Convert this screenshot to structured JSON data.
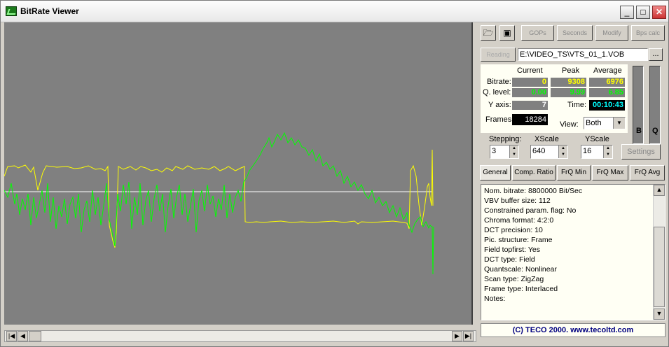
{
  "window": {
    "title": "BitRate Viewer"
  },
  "toolbar": {
    "open_icon": "folder-open-icon",
    "save_icon": "floppy-save-icon",
    "gops": "GOPs",
    "seconds": "Seconds",
    "modify": "Modify",
    "bps_calc": "Bps calc"
  },
  "file": {
    "reading_label": "Reading",
    "path": "E:\\VIDEO_TS\\VTS_01_1.VOB",
    "browse": "..."
  },
  "stats": {
    "headers": {
      "current": "Current",
      "peak": "Peak",
      "average": "Average"
    },
    "bitrate": {
      "label": "Bitrate:",
      "current": "0",
      "peak": "9308",
      "average": "6976"
    },
    "qlevel": {
      "label": "Q. level:",
      "current": "0.00",
      "peak": "9.99",
      "average": "6.85"
    },
    "yaxis": {
      "label": "Y axis:",
      "current": "7"
    },
    "time": {
      "label": "Time:",
      "value": "00:10:43"
    },
    "frames": {
      "label": "Frames:",
      "value": "18284"
    },
    "view": {
      "label": "View:",
      "value": "Both"
    }
  },
  "meters": {
    "b_label": "B",
    "q_label": "Q"
  },
  "controls": {
    "stepping": {
      "label": "Stepping:",
      "value": "3"
    },
    "xscale": {
      "label": "XScale",
      "value": "640"
    },
    "yscale": {
      "label": "YScale",
      "value": "16"
    },
    "settings": "Settings"
  },
  "tabs": [
    "General",
    "Comp. Ratio",
    "FrQ Min",
    "FrQ Max",
    "FrQ Avg"
  ],
  "info_lines": [
    "Nom. bitrate: 8800000 Bit/Sec",
    "VBV buffer size: 112",
    "Constrained param. flag: No",
    "Chroma format: 4:2:0",
    "DCT precision: 10",
    "Pic. structure: Frame",
    "Field topfirst: Yes",
    "DCT type: Field",
    "Quantscale: Nonlinear",
    "Scan type: ZigZag",
    "Frame type: Interlaced",
    "Notes:"
  ],
  "footer": "(C) TECO 2000. www.tecoltd.com",
  "colors": {
    "bitrate_line": "#ffff00",
    "qlevel_line": "#00ff00",
    "average_line": "#ffffff",
    "graph_bg": "#808080"
  }
}
